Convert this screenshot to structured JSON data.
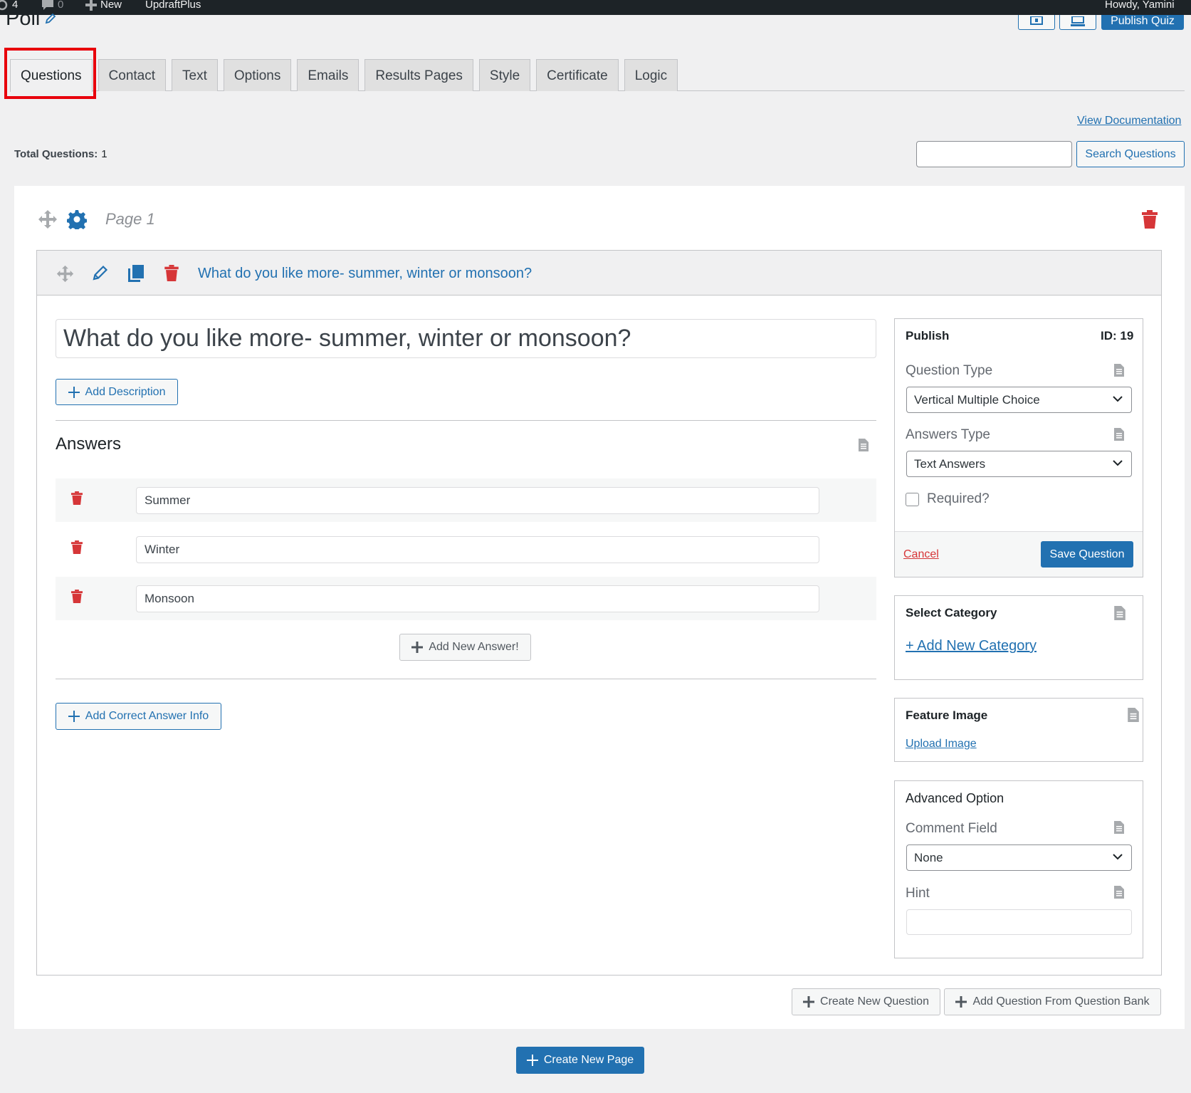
{
  "admin_bar": {
    "updates_count": "4",
    "comments_count": "0",
    "new_label": "New",
    "plugin_label": "UpdraftPlus",
    "greeting": "Howdy, Yamini"
  },
  "header": {
    "title": "Poll",
    "publish_label": "Publish Quiz"
  },
  "tabs": [
    "Questions",
    "Contact",
    "Text",
    "Options",
    "Emails",
    "Results Pages",
    "Style",
    "Certificate",
    "Logic"
  ],
  "toolbar": {
    "view_docs": "View Documentation",
    "total_label": "Total Questions:",
    "total_value": "1",
    "search_button": "Search Questions",
    "search_value": ""
  },
  "page_block": {
    "label": "Page 1"
  },
  "question": {
    "header_title": "What do you like more- summer, winter or monsoon?",
    "title_value": "What do you like more- summer, winter or monsoon?",
    "add_description": "Add Description",
    "answers_heading": "Answers",
    "answers": [
      "Summer",
      "Winter",
      "Monsoon"
    ],
    "add_answer": "Add New Answer!",
    "add_correct_info": "Add Correct Answer Info"
  },
  "publish_panel": {
    "title": "Publish",
    "id_label": "ID: 19",
    "question_type_label": "Question Type",
    "question_type_value": "Vertical Multiple Choice",
    "answers_type_label": "Answers Type",
    "answers_type_value": "Text Answers",
    "required_label": "Required?",
    "cancel": "Cancel",
    "save": "Save Question"
  },
  "category_panel": {
    "title": "Select Category",
    "add_link": "+ Add New Category"
  },
  "feature_panel": {
    "title": "Feature Image",
    "upload_link": "Upload Image"
  },
  "advanced_panel": {
    "title": "Advanced Option",
    "comment_label": "Comment Field",
    "comment_value": "None",
    "hint_label": "Hint",
    "hint_value": ""
  },
  "footer": {
    "create_question": "Create New Question",
    "from_bank": "Add Question From Question Bank",
    "create_page": "Create New Page"
  },
  "colors": {
    "accent": "#2271b1",
    "danger": "#d63638",
    "highlight_box": "#e8000b",
    "admin_bar": "#1d2327"
  }
}
